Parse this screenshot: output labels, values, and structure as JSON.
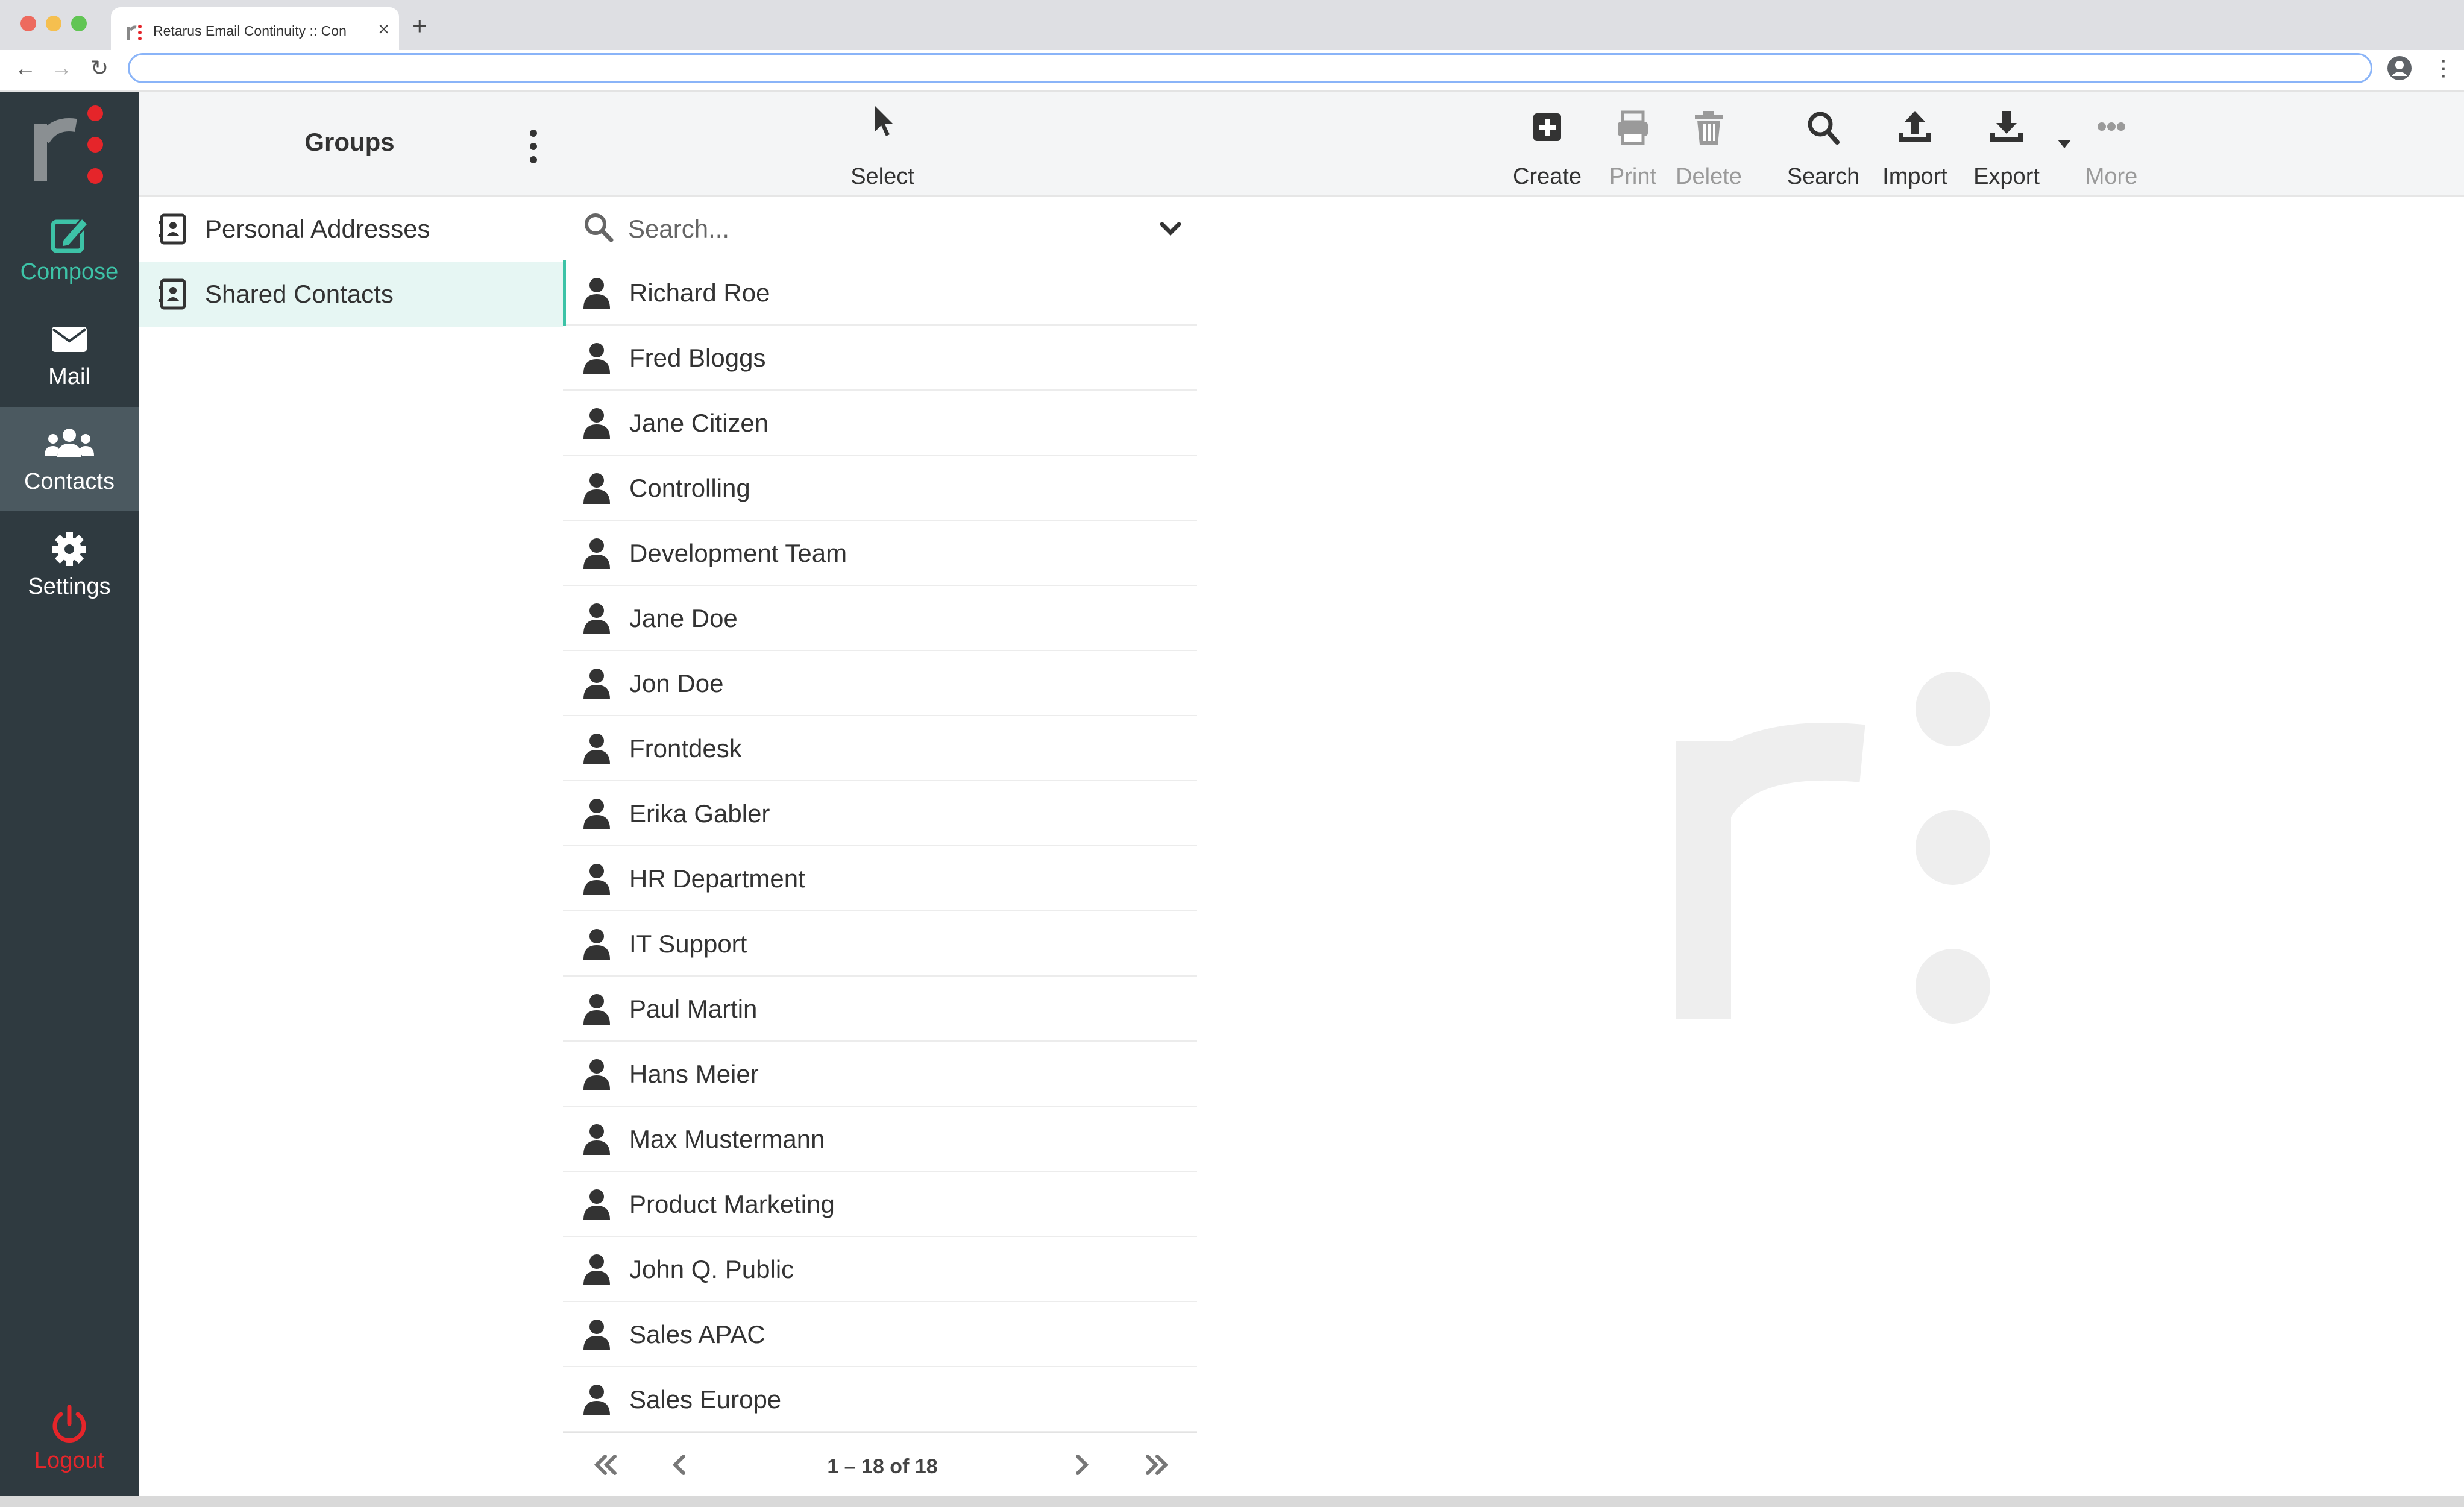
{
  "browser": {
    "tab_title": "Retarus Email Continuity :: Con",
    "new_tab_symbol": "+",
    "close_symbol": "×",
    "address_value": ""
  },
  "sidebar": {
    "items": [
      {
        "label": "Compose",
        "icon": "compose-icon"
      },
      {
        "label": "Mail",
        "icon": "envelope-icon"
      },
      {
        "label": "Contacts",
        "icon": "users-icon"
      },
      {
        "label": "Settings",
        "icon": "gear-icon"
      }
    ],
    "logout": {
      "label": "Logout",
      "icon": "power-icon"
    },
    "active": "Contacts"
  },
  "groups": {
    "title": "Groups",
    "items": [
      {
        "label": "Personal Addresses"
      },
      {
        "label": "Shared Contacts"
      }
    ],
    "selected": "Shared Contacts"
  },
  "list": {
    "select_label": "Select",
    "search_placeholder": "Search...",
    "contacts": [
      "Richard Roe",
      "Fred Bloggs",
      "Jane Citizen",
      "Controlling",
      "Development Team",
      "Jane Doe",
      "Jon Doe",
      "Frontdesk",
      "Erika Gabler",
      "HR Department",
      "IT Support",
      "Paul Martin",
      "Hans Meier",
      "Max Mustermann",
      "Product Marketing",
      "John Q. Public",
      "Sales APAC",
      "Sales Europe"
    ],
    "pagination": "1 – 18 of 18"
  },
  "toolbar": {
    "create": "Create",
    "print": "Print",
    "delete": "Delete",
    "search": "Search",
    "import": "Import",
    "export": "Export",
    "more": "More",
    "disabled": [
      "Print",
      "Delete",
      "More"
    ]
  },
  "colors": {
    "accent": "#3dc3a7",
    "brand_red": "#e5252a",
    "sidebar_bg": "#2f3a40",
    "sidebar_active": "#4b5960",
    "selected_group_bg": "#e6f6f3"
  }
}
